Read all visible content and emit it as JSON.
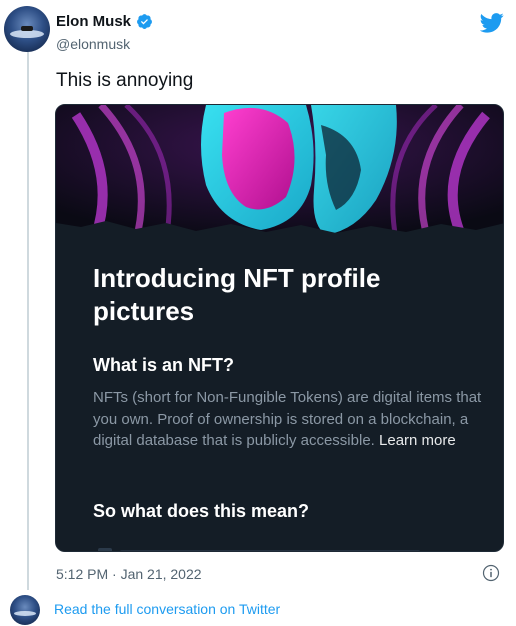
{
  "author": {
    "display_name": "Elon Musk",
    "handle": "@elonmusk",
    "verified": true
  },
  "tweet": {
    "text": "This is annoying",
    "timestamp": "5:12 PM · Jan 21, 2022"
  },
  "card": {
    "title": "Introducing NFT profile pictures",
    "heading_1": "What is an NFT?",
    "body": "NFTs (short for Non-Fungible Tokens) are digital items that you own. Proof of ownership is stored on a blockchain, a digital database that is publicly accessible.",
    "learn_more": "Learn more",
    "heading_2": "So what does this mean?"
  },
  "footer": {
    "read_conversation": "Read the full conversation on Twitter"
  },
  "colors": {
    "twitter_blue": "#1d9bf0",
    "card_background": "#141d26",
    "secondary_text": "#536471"
  },
  "icons": {
    "brand": "twitter-bird-icon",
    "verified": "verified-badge-icon",
    "info": "info-icon"
  }
}
